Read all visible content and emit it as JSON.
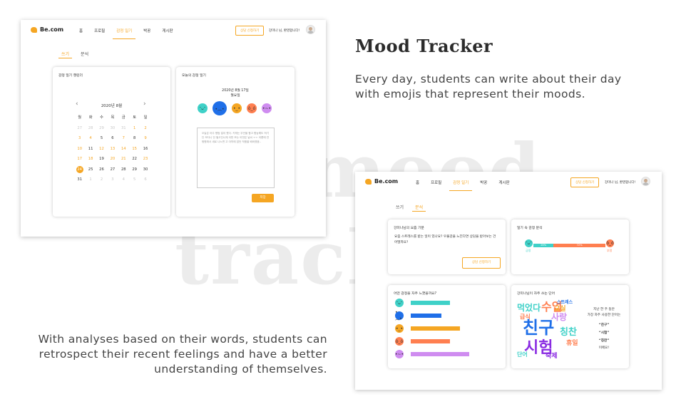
{
  "background_words": [
    "mood",
    "track"
  ],
  "headline": "Mood Tracker",
  "description_top": "Every day, students can write about their day with emojis that represent their moods.",
  "description_bottom": "With analyses based on their words, students can retrospect their recent feelings and have a better understanding of themselves.",
  "accent_color": "#f5a623",
  "nav": {
    "logo": "Be.com",
    "links": [
      "홈",
      "프로필",
      "감정 일기",
      "박꿍",
      "게시판"
    ],
    "active_index": 2,
    "consult_label": "상담 신청하기",
    "welcome": "강미나 님, 환영합니다!"
  },
  "screen1": {
    "tabs": [
      "쓰기",
      "분석"
    ],
    "active_tab": 0,
    "calendar": {
      "title": "감정 일기 캘린더",
      "month": "2020년 8월",
      "weekdays": [
        "월",
        "화",
        "수",
        "목",
        "금",
        "토",
        "일"
      ],
      "days": [
        [
          "27",
          "28",
          "29",
          "30",
          "31",
          "1",
          "2"
        ],
        [
          "3",
          "4",
          "5",
          "6",
          "7",
          "8",
          "9"
        ],
        [
          "10",
          "11",
          "12",
          "13",
          "14",
          "15",
          "16"
        ],
        [
          "17",
          "18",
          "19",
          "20",
          "21",
          "22",
          "23"
        ],
        [
          "24",
          "25",
          "26",
          "27",
          "28",
          "29",
          "30"
        ],
        [
          "31",
          "1",
          "2",
          "3",
          "4",
          "5",
          "6"
        ]
      ],
      "muted": [
        "0-0",
        "0-1",
        "0-2",
        "0-3",
        "0-4",
        "5-1",
        "5-2",
        "5-3",
        "5-4",
        "5-5",
        "5-6"
      ],
      "highlighted": [
        "0-5",
        "0-6",
        "1-0",
        "1-1",
        "1-4",
        "1-6",
        "2-0",
        "2-2",
        "2-3",
        "2-4",
        "2-5",
        "3-0",
        "3-1",
        "3-3",
        "3-4",
        "3-6"
      ],
      "today": "4-0"
    },
    "diary": {
      "title": "오늘의 감정 일기",
      "date": "2020년 8월 17일",
      "weekday": "월요일",
      "emotions": [
        {
          "name": "happy",
          "color": "#3fd1c8",
          "face": "ᵔᴗᵔ"
        },
        {
          "name": "sad",
          "color": "#1f6fe8",
          "face": "•︵•"
        },
        {
          "name": "neutral",
          "color": "#f5a623",
          "face": "•_•"
        },
        {
          "name": "angry",
          "color": "#ff7f50",
          "face": "ò_ó"
        },
        {
          "name": "worried",
          "color": "#cf8cf0",
          "face": "•~•"
        }
      ],
      "selected_emotion": 1,
      "text": "오늘은 아주 평범 일이 왔다. 키캐는 무언을 합고 합능해도 허기 단 모다니 던 필고단나게 이번 모는 이번은 날씨 ㅜㅜ 이름에 연짱원에서 새로 나노면 고 아까에 잡던 작품을 배바졌음..",
      "save_label": "저장"
    }
  },
  "screen2": {
    "tabs": [
      "쓰기",
      "분석"
    ],
    "active_tab": 1,
    "recent": {
      "title": "강미나님의 요즘 기분",
      "message": "요즘 스트레스를 받는 일이 있나요? 우울감을 느낀다면 상담을 받아보는 건 어떨까요?",
      "button": "상담 신청하기"
    },
    "ratio": {
      "title": "일기 속 감정 분석",
      "positive_label": "긍정",
      "negative_label": "부정",
      "positive_pct": 28,
      "negative_pct": 72,
      "positive_text": "28%",
      "negative_text": "72%"
    },
    "frequency": {
      "title": "어떤 감정을 자주 느꼈을까요?",
      "values": [
        0.62,
        0.48,
        0.77,
        0.62,
        0.92
      ]
    },
    "words": {
      "title": "강미나님이 자주 쓰는 단어",
      "caption": [
        "지난 한 주 동안",
        "가장 자주 사용한 단어는"
      ],
      "top": [
        "“친구”",
        "“시험”",
        "“칭찬”"
      ],
      "suffix": "이에요!",
      "cloud": [
        {
          "t": "친구",
          "c": "#1f6fe8"
        },
        {
          "t": "시험",
          "c": "#8a2be2"
        },
        {
          "t": "수업",
          "c": "#ff7f50"
        },
        {
          "t": "먹었다",
          "c": "#3fd1c8"
        },
        {
          "t": "사랑",
          "c": "#cf8cf0"
        },
        {
          "t": "교실",
          "c": "#f5a623"
        },
        {
          "t": "칭찬",
          "c": "#3fd1c8"
        },
        {
          "t": "급식",
          "c": "#ff7f50"
        },
        {
          "t": "단어",
          "c": "#3fd1c8"
        },
        {
          "t": "스트레스",
          "c": "#1f6fe8"
        },
        {
          "t": "휴일",
          "c": "#ff7f50"
        },
        {
          "t": "숙제",
          "c": "#8a2be2"
        }
      ]
    }
  }
}
